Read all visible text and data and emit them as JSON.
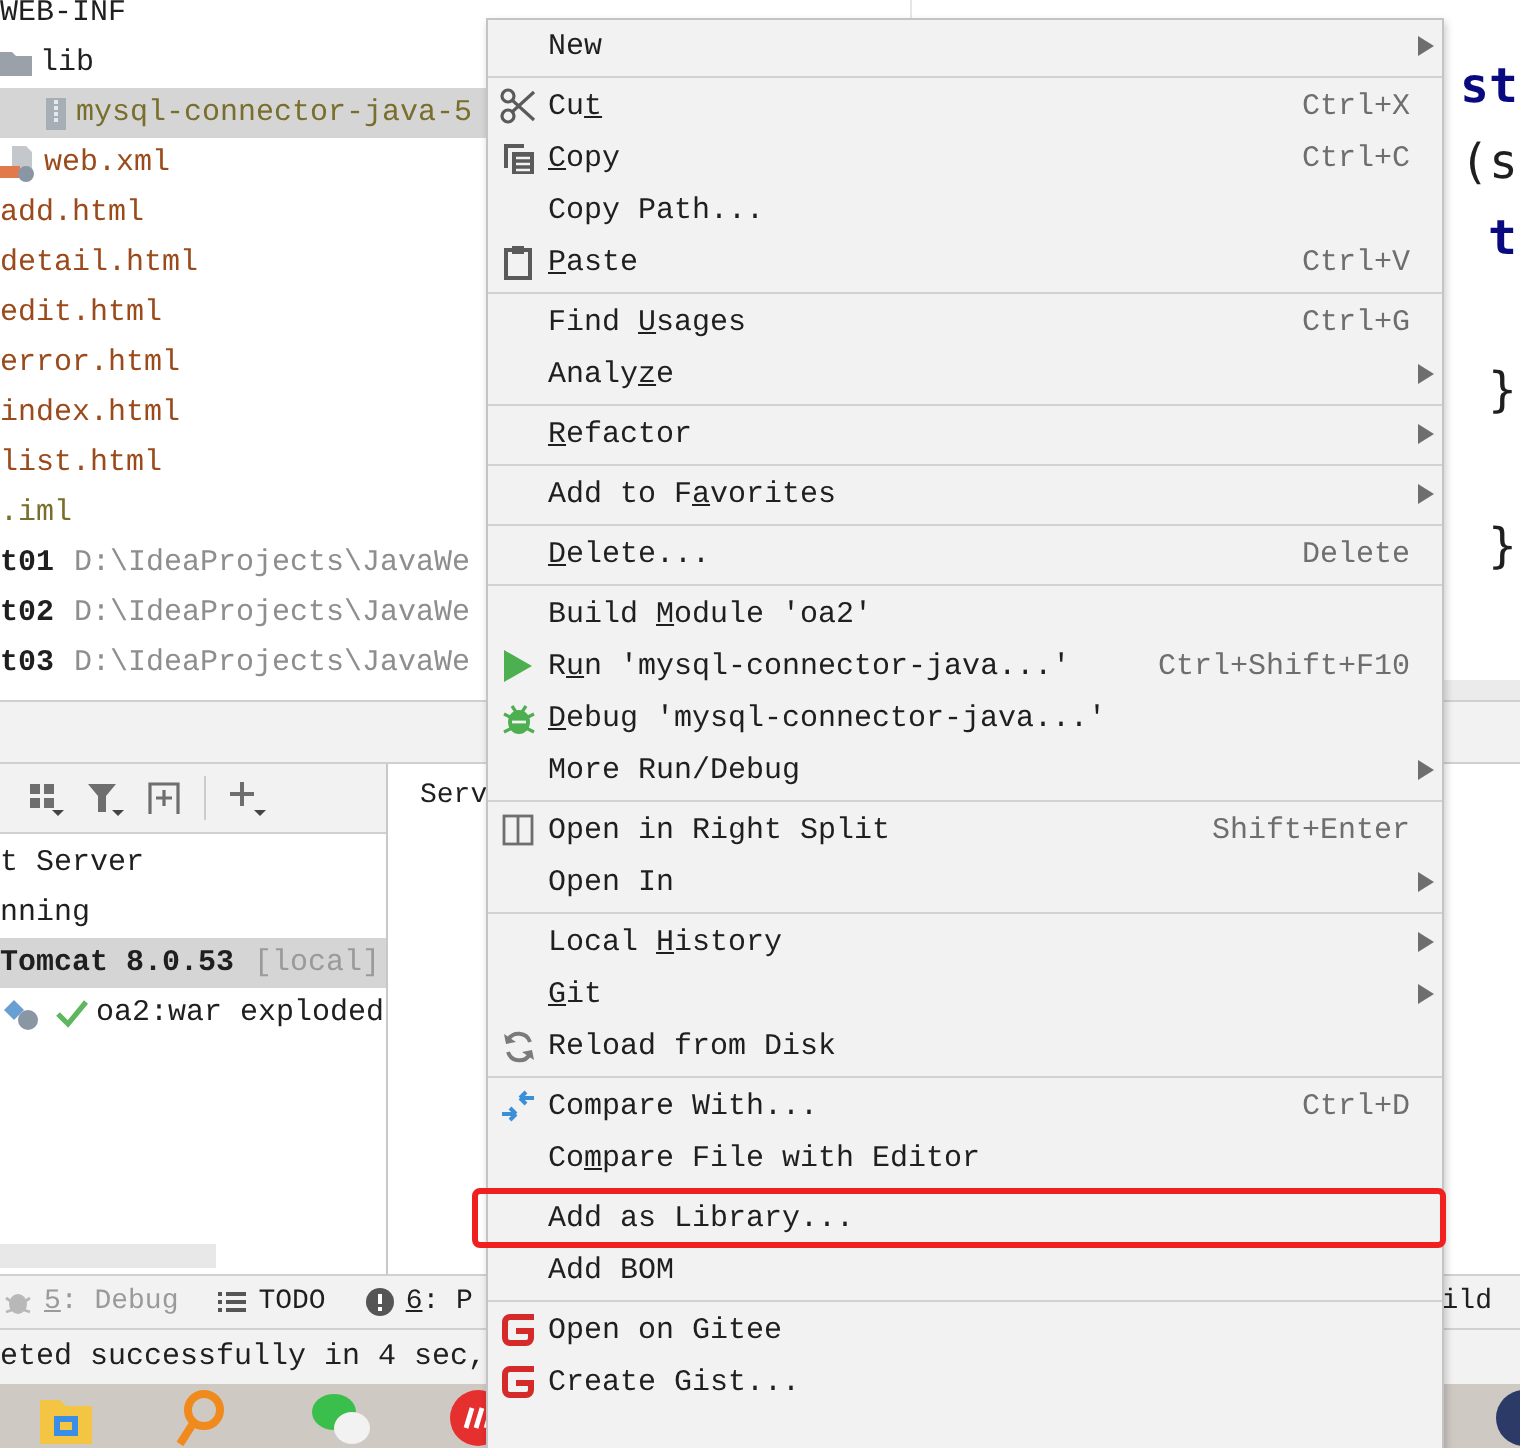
{
  "project_tree": [
    {
      "label": "WEB-INF",
      "color": "#1f1f1f",
      "bold": false,
      "selected": false,
      "children": [
        {
          "label": "lib",
          "color": "#1f1f1f",
          "bold": false,
          "selected": false,
          "children": [
            {
              "label": "mysql-connector-java-5",
              "color": "#7a6e2c",
              "bold": false,
              "selected": true
            }
          ]
        },
        {
          "label": "web.xml",
          "color": "#9b4a1c",
          "bold": false,
          "selected": false
        }
      ]
    },
    {
      "label": "add.html",
      "color": "#9b4a1c",
      "bold": false,
      "selected": false
    },
    {
      "label": "detail.html",
      "color": "#9b4a1c",
      "bold": false,
      "selected": false
    },
    {
      "label": "edit.html",
      "color": "#9b4a1c",
      "bold": false,
      "selected": false
    },
    {
      "label": "error.html",
      "color": "#9b4a1c",
      "bold": false,
      "selected": false
    },
    {
      "label": "index.html",
      "color": "#9b4a1c",
      "bold": false,
      "selected": false
    },
    {
      "label": "list.html",
      "color": "#9b4a1c",
      "bold": false,
      "selected": false
    },
    {
      "label": ".iml",
      "color": "#7a6e2c",
      "bold": false,
      "selected": false
    },
    {
      "label": "t01",
      "path": "D:\\IdeaProjects\\JavaWe",
      "color": "#1f1f1f",
      "bold": true,
      "selected": false
    },
    {
      "label": "t02",
      "path": "D:\\IdeaProjects\\JavaWe",
      "color": "#1f1f1f",
      "bold": true,
      "selected": false
    },
    {
      "label": "t03",
      "path": "D:\\IdeaProjects\\JavaWe",
      "color": "#1f1f1f",
      "bold": true,
      "selected": false
    }
  ],
  "editor": {
    "code_fragments": [
      {
        "text": "st",
        "kind": "keyword"
      },
      {
        "text": "(s",
        "kind": "plain"
      },
      {
        "text": "t",
        "kind": "keyword"
      },
      {
        "text": "}",
        "kind": "plain"
      },
      {
        "text": "}",
        "kind": "plain"
      }
    ]
  },
  "services": {
    "tab_title": "Serv",
    "tree": [
      {
        "label": "t Server",
        "selected": false
      },
      {
        "label": "nning",
        "selected": false
      },
      {
        "label": "Tomcat 8.0.53",
        "suffix": "[local]",
        "selected": true,
        "children": [
          {
            "label": "oa2:war exploded",
            "selected": false
          }
        ]
      }
    ]
  },
  "tool_window_bar": {
    "tabs": [
      {
        "mnemonic": "5",
        "after": ": Debug",
        "disabled": true
      },
      {
        "before": "TODO",
        "disabled": false
      },
      {
        "mnemonic": "6",
        "after": ": P",
        "disabled": false
      }
    ],
    "right_label": "ild"
  },
  "status_bar": {
    "message": "eted successfully in 4 sec,"
  },
  "context_menu": {
    "groups": [
      {
        "items": [
          {
            "before": "New",
            "submenu": true,
            "highlighted": false
          }
        ]
      },
      {
        "items": [
          {
            "before": "Cu",
            "mnemonic": "t",
            "shortcut": "Ctrl+X",
            "submenu": false,
            "highlighted": false
          },
          {
            "mnemonic": "C",
            "after": "opy",
            "shortcut": "Ctrl+C",
            "submenu": false,
            "highlighted": false
          },
          {
            "before": "Copy Path...",
            "submenu": false,
            "highlighted": false
          },
          {
            "mnemonic": "P",
            "after": "aste",
            "shortcut": "Ctrl+V",
            "submenu": false,
            "highlighted": false
          }
        ]
      },
      {
        "items": [
          {
            "before": "Find ",
            "mnemonic": "U",
            "after": "sages",
            "shortcut": "Ctrl+G",
            "submenu": false,
            "highlighted": false
          },
          {
            "before": "Analy",
            "mnemonic": "z",
            "after": "e",
            "submenu": true,
            "highlighted": false
          }
        ]
      },
      {
        "items": [
          {
            "mnemonic": "R",
            "after": "efactor",
            "submenu": true,
            "highlighted": false
          }
        ]
      },
      {
        "items": [
          {
            "before": "Add to F",
            "mnemonic": "a",
            "after": "vorites",
            "submenu": true,
            "highlighted": false
          }
        ]
      },
      {
        "items": [
          {
            "mnemonic": "D",
            "after": "elete...",
            "shortcut": "Delete",
            "submenu": false,
            "highlighted": false
          }
        ]
      },
      {
        "items": [
          {
            "before": "Build ",
            "mnemonic": "M",
            "after": "odule 'oa2'",
            "submenu": false,
            "highlighted": false
          },
          {
            "before": "R",
            "mnemonic": "u",
            "after": "n 'mysql-connector-java...'",
            "shortcut": "Ctrl+Shift+F10",
            "submenu": false,
            "highlighted": false
          },
          {
            "mnemonic": "D",
            "after": "ebug 'mysql-connector-java...'",
            "submenu": false,
            "highlighted": false
          },
          {
            "before": "More Run/Debug",
            "submenu": true,
            "highlighted": false
          }
        ]
      },
      {
        "items": [
          {
            "before": "Open in Right Split",
            "shortcut": "Shift+Enter",
            "submenu": false,
            "highlighted": false
          },
          {
            "before": "Open In",
            "submenu": true,
            "highlighted": false
          }
        ]
      },
      {
        "items": [
          {
            "before": "Local ",
            "mnemonic": "H",
            "after": "istory",
            "submenu": true,
            "highlighted": false
          },
          {
            "mnemonic": "G",
            "after": "it",
            "submenu": true,
            "highlighted": false
          },
          {
            "before": "Reload from Disk",
            "submenu": false,
            "highlighted": false
          }
        ]
      },
      {
        "items": [
          {
            "before": "Compare With...",
            "shortcut": "Ctrl+D",
            "submenu": false,
            "highlighted": false
          },
          {
            "before": "Co",
            "mnemonic": "m",
            "after": "pare File with Editor",
            "submenu": false,
            "highlighted": false
          }
        ]
      },
      {
        "items": [
          {
            "before": "Add as Library...",
            "submenu": false,
            "highlighted": true
          },
          {
            "before": "Add BOM",
            "submenu": false,
            "highlighted": false
          }
        ]
      },
      {
        "items": [
          {
            "before": "Open on Gitee",
            "submenu": false,
            "highlighted": false
          },
          {
            "before": "Create Gist...",
            "submenu": false,
            "highlighted": false
          }
        ]
      }
    ]
  }
}
